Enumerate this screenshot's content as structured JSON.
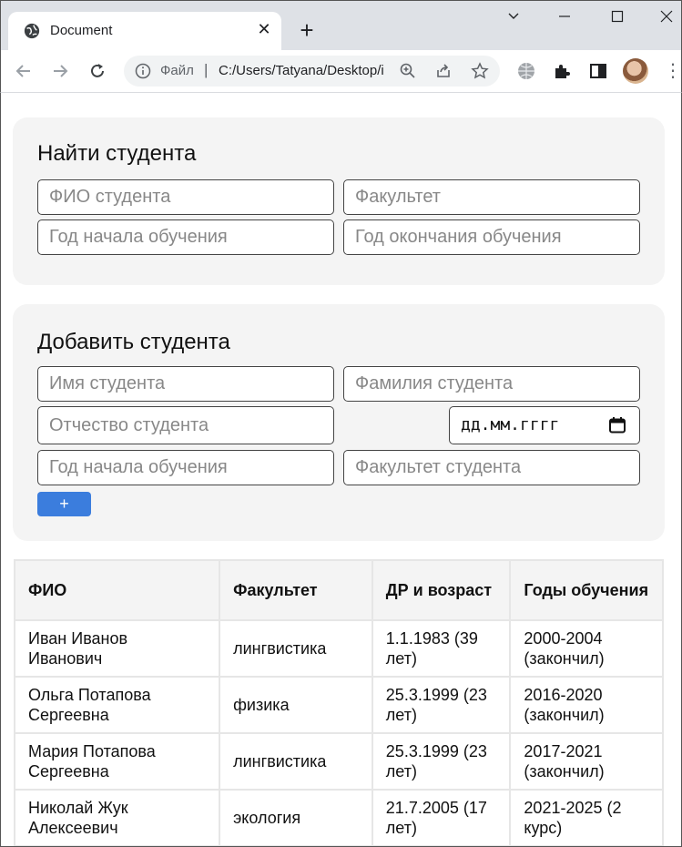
{
  "browser": {
    "tab_title": "Document",
    "scheme_label": "Файл",
    "separator": "|",
    "url": "C:/Users/Tatyana/Desktop/index.html"
  },
  "search": {
    "title": "Найти студента",
    "placeholders": {
      "name": "ФИО студента",
      "faculty": "Факультет",
      "start_year": "Год начала обучения",
      "end_year": "Год окончания обучения"
    }
  },
  "add": {
    "title": "Добавить студента",
    "placeholders": {
      "first_name": "Имя студента",
      "last_name": "Фамилия студента",
      "patronymic": "Отчество студента",
      "birth_date": "дд.мм.гггг",
      "start_year": "Год начала обучения",
      "faculty": "Факультет студента"
    },
    "add_button_label": "+"
  },
  "table": {
    "headers": [
      "ФИО",
      "Факультет",
      "ДР и возраст",
      "Годы обучения"
    ],
    "rows": [
      [
        "Иван Иванов Иванович",
        "лингвистика",
        "1.1.1983 (39 лет)",
        "2000-2004 (закончил)"
      ],
      [
        "Ольга Потапова Сергеевна",
        "физика",
        "25.3.1999 (23 лет)",
        "2016-2020 (закончил)"
      ],
      [
        "Мария Потапова Сергеевна",
        "лингвистика",
        "25.3.1999 (23 лет)",
        "2017-2021 (закончил)"
      ],
      [
        "Николай Жук Алексеевич",
        "экология",
        "21.7.2005 (17 лет)",
        "2021-2025 (2 курс)"
      ]
    ]
  },
  "colors": {
    "accent": "#3b7ddd",
    "card_bg": "#f4f4f4"
  }
}
